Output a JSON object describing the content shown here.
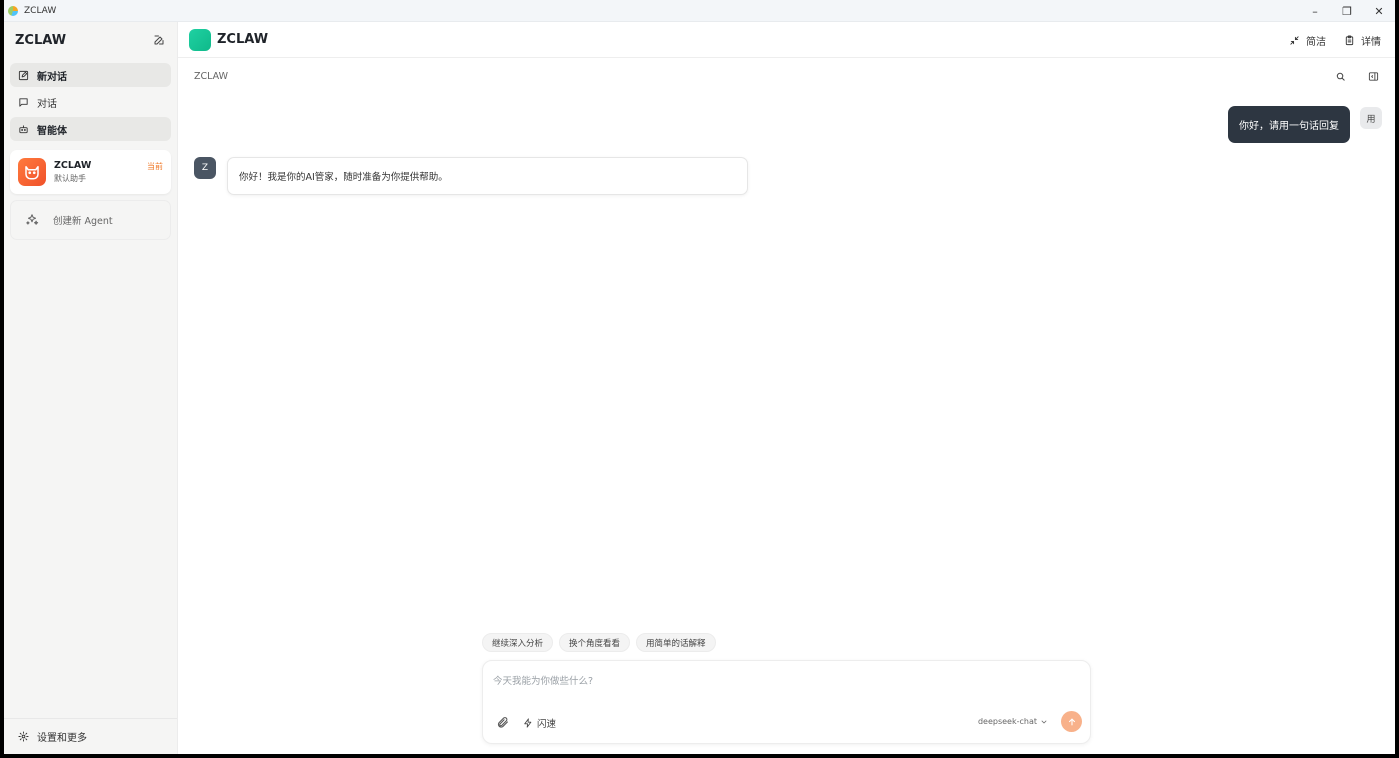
{
  "window": {
    "title": "ZCLAW",
    "controls": {
      "minimize": "–",
      "restore": "❐",
      "close": "✕"
    }
  },
  "sidebar": {
    "title": "ZCLAW",
    "nav": [
      {
        "label": "新对话",
        "icon": "edit-icon",
        "active": true
      },
      {
        "label": "对话",
        "icon": "chat-bubble-icon",
        "active": false
      },
      {
        "label": "智能体",
        "icon": "bot-icon",
        "active": true
      }
    ],
    "agent": {
      "name": "ZCLAW",
      "description": "默认助手",
      "badge": "当前"
    },
    "create_agent": "创建新 Agent",
    "footer": "设置和更多"
  },
  "header": {
    "brand": "ZCLAW",
    "compact_label": "简洁",
    "details_label": "详情"
  },
  "subbar": {
    "crumb": "ZCLAW"
  },
  "messages": {
    "user_avatar": "用",
    "user_text": "你好，请用一句话回复",
    "ai_avatar": "Z",
    "ai_text": "你好！我是你的AI管家，随时准备为你提供帮助。"
  },
  "suggestions": [
    "继续深入分析",
    "换个角度看看",
    "用简单的话解释"
  ],
  "composer": {
    "placeholder": "今天我能为你做些什么?",
    "mode": "闪速",
    "model": "deepseek-chat"
  },
  "colors": {
    "accent": "#f07b2b",
    "brand": "#1fd1a2",
    "user_bubble": "#2d3641",
    "send_button": "#f8b18a"
  }
}
